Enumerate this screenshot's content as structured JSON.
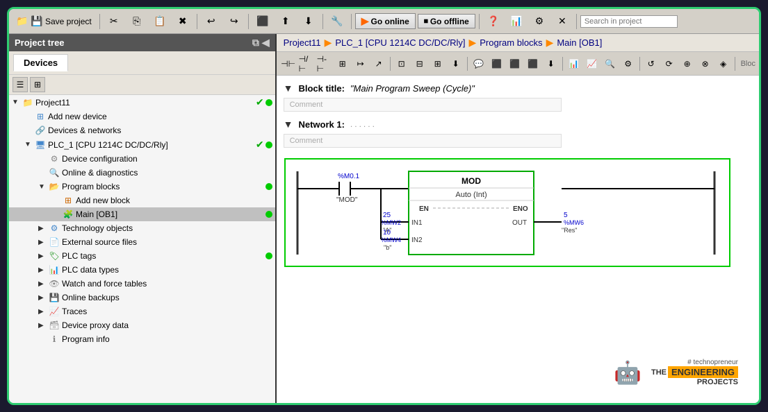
{
  "toolbar": {
    "save_label": "Save project",
    "go_online_label": "Go online",
    "go_offline_label": "Go offline",
    "search_placeholder": "Search in project"
  },
  "project_tree": {
    "header_label": "Project tree",
    "devices_tab": "Devices"
  },
  "breadcrumb": {
    "project": "Project11",
    "plc": "PLC_1 [CPU 1214C DC/DC/Rly]",
    "blocks": "Program blocks",
    "main": "Main [OB1]"
  },
  "block_title": {
    "label": "Block title:",
    "value": "\"Main Program Sweep (Cycle)\"",
    "comment_placeholder": "Comment"
  },
  "network": {
    "label": "Network 1:",
    "dots": "......",
    "comment_placeholder": "Comment"
  },
  "mod_block": {
    "title": "MOD",
    "subtitle": "Auto (Int)",
    "en": "EN",
    "eno": "ENO",
    "in1": "IN1",
    "in2": "IN2",
    "out": "OUT"
  },
  "contact": {
    "address": "%M0.1",
    "name": "\"MOD\""
  },
  "in1_values": {
    "number": "25",
    "var": "%MW2",
    "name": "\"A\""
  },
  "in2_values": {
    "number": "10",
    "var": "%MW4",
    "name": "\"b\""
  },
  "out_values": {
    "number": "5",
    "var": "%MW6",
    "name": "\"Res\""
  },
  "tree_items": [
    {
      "label": "Project11",
      "level": 0,
      "expanded": true,
      "type": "project",
      "has_status": true
    },
    {
      "label": "Add new device",
      "level": 1,
      "expanded": false,
      "type": "add"
    },
    {
      "label": "Devices & networks",
      "level": 1,
      "expanded": false,
      "type": "devices"
    },
    {
      "label": "PLC_1 [CPU 1214C DC/DC/Rly]",
      "level": 1,
      "expanded": true,
      "type": "plc",
      "has_status": true
    },
    {
      "label": "Device configuration",
      "level": 2,
      "expanded": false,
      "type": "config"
    },
    {
      "label": "Online & diagnostics",
      "level": 2,
      "expanded": false,
      "type": "diag"
    },
    {
      "label": "Program blocks",
      "level": 2,
      "expanded": true,
      "type": "folder",
      "has_dot": true
    },
    {
      "label": "Add new block",
      "level": 3,
      "expanded": false,
      "type": "add_block"
    },
    {
      "label": "Main [OB1]",
      "level": 3,
      "expanded": false,
      "type": "main_block",
      "highlighted": true,
      "has_dot": true
    },
    {
      "label": "Technology objects",
      "level": 2,
      "expanded": false,
      "type": "tech"
    },
    {
      "label": "External source files",
      "level": 2,
      "expanded": false,
      "type": "ext"
    },
    {
      "label": "PLC tags",
      "level": 2,
      "expanded": false,
      "type": "tags",
      "has_dot": true
    },
    {
      "label": "PLC data types",
      "level": 2,
      "expanded": false,
      "type": "datatypes"
    },
    {
      "label": "Watch and force tables",
      "level": 2,
      "expanded": false,
      "type": "watch"
    },
    {
      "label": "Online backups",
      "level": 2,
      "expanded": false,
      "type": "backups"
    },
    {
      "label": "Traces",
      "level": 2,
      "expanded": false,
      "type": "traces"
    },
    {
      "label": "Device proxy data",
      "level": 2,
      "expanded": false,
      "type": "proxy"
    },
    {
      "label": "Program info",
      "level": 2,
      "expanded": false,
      "type": "info"
    }
  ],
  "watermark": {
    "technopreneur": "# technopreneur",
    "the": "THE",
    "engineering": "ENGINEERING",
    "projects": "PROJECTS"
  }
}
